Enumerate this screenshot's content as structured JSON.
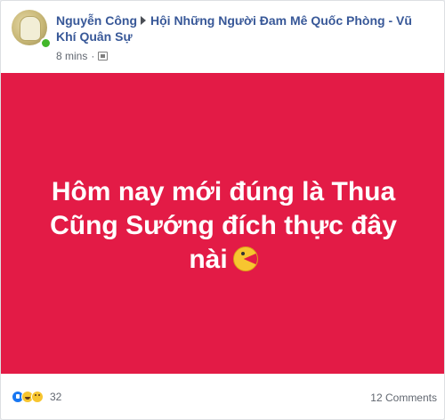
{
  "post": {
    "author": "Nguyễn Công",
    "group": "Hội Những Người Đam Mê Quốc Phòng - Vũ Khí Quân Sự",
    "time": "8 mins",
    "audience_icon": "group-audience-icon",
    "text": "Hôm nay mới đúng là Thua Cũng Sướng đích thực đây nài",
    "emoji": "pacman-emoji-icon",
    "background_color": "#e31b46"
  },
  "footer": {
    "reactions": [
      "like-icon",
      "haha-icon",
      "sad-icon"
    ],
    "reaction_count": "32",
    "comments": "12 Comments"
  }
}
